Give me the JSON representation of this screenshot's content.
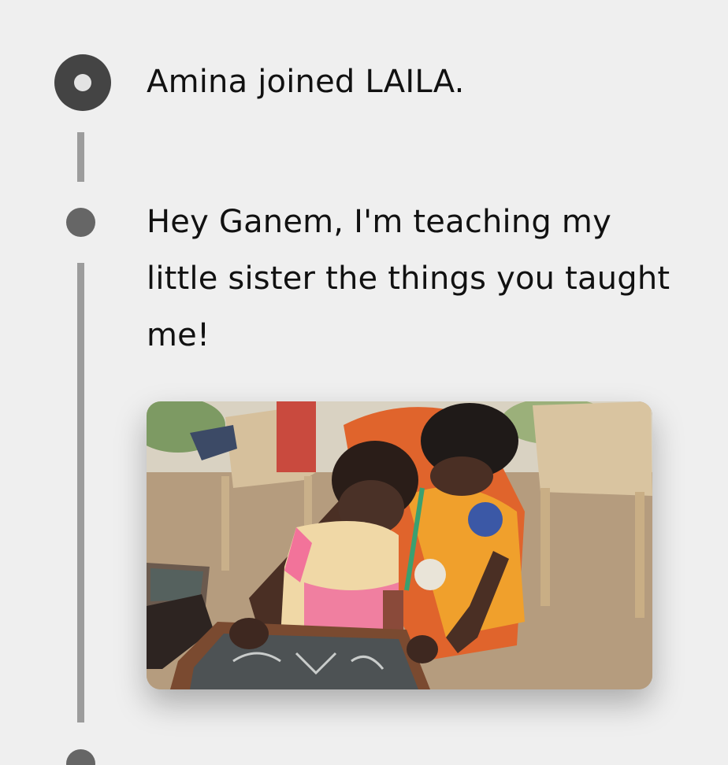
{
  "timeline": {
    "events": [
      {
        "text": "Amina joined LAILA."
      },
      {
        "text": "Hey Ganem, I'm teaching my little sister the things you taught me!",
        "photo": {
          "icon": "photo-of-woman-teaching-child-on-chalkboard"
        }
      }
    ]
  },
  "colors": {
    "background": "#efefef",
    "timeline_line": "#9c9c9c",
    "node_dark": "#444444",
    "node": "#666666",
    "text": "#111111"
  }
}
